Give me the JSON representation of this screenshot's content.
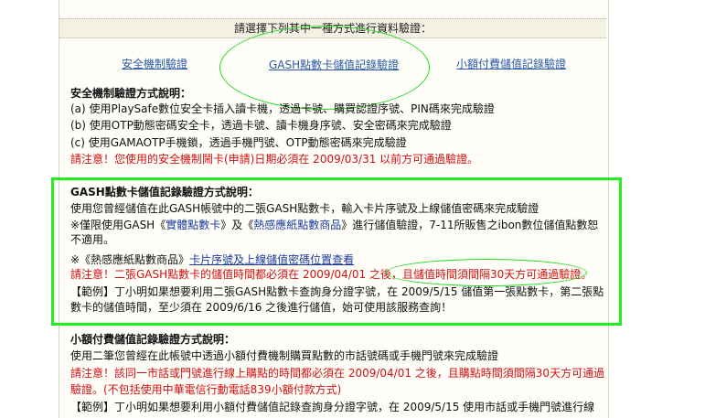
{
  "header": {
    "prompt": "請選擇下列其中一種方式進行資料驗證："
  },
  "tabs": [
    {
      "label": "安全機制驗證"
    },
    {
      "label": "GASH點數卡儲值記錄驗證"
    },
    {
      "label": "小額付費儲值記錄驗證"
    }
  ],
  "safety": {
    "title": "安全機制驗證方式說明：",
    "line_a": "(a) 使用PlaySafe數位安全卡插入讀卡機，透過卡號、購買認證序號、PIN碼來完成驗證",
    "line_b": "(b) 使用OTP動態密碼安全卡，透過卡號、讀卡機身序號、安全密碼來完成驗證",
    "line_c": "(c) 使用GAMAOTP手機鎖，透過手機門號、OTP動態密碼來完成驗證",
    "notice": "請注意！您使用的安全機制鬧卡(申請)日期必須在 2009/03/31 以前方可通過驗證。"
  },
  "gash": {
    "title": "GASH點數卡儲值記錄驗證方式說明：",
    "line1": "使用您曾經儲值在此GASH帳號中的二張GASH點數卡，輸入卡片序號及上線儲值密碼來完成驗證",
    "line2_pre": "※僅限使用GASH《",
    "line2_link1": "實體點數卡",
    "line2_mid": "》及《",
    "line2_link2": "熱感應紙點數商品",
    "line2_post": "》進行儲值驗證，7-11所販售之ibon數位儲值點數恕",
    "line3": "不適用。",
    "line4_pre": "※《熱感應紙點數商品》",
    "line4_link": "卡片序號及上線儲值密碼位置查看",
    "notice": "請注意！二張GASH點數卡的儲值時間都必須在 2009/04/01 之後，且儲值時間須間隔30天方可通過驗證。",
    "example1": "【範例】丁小明如果想要利用二張GASH點數卡查詢身分證字號，在 2009/5/15 儲值第一張點數卡，第二張點",
    "example2": "數卡的儲值時間，至少須在 2009/6/16 之後進行儲值，始可使用該服務查詢！"
  },
  "micro": {
    "title": "小額付費儲值記錄驗證方式說明：",
    "line1": "使用二筆您曾經在此帳號中透過小額付費機制購買點數的市話號碼或手機門號來完成驗證",
    "notice1": "請注意！該同一市話或門號進行線上購點的時間都必須在 2009/04/01 之後，且購點時間須間隔30天方可通過",
    "notice2": "驗證。(不包括使用中華電信行動電話839小額付款方式)",
    "example": "【範例】丁小明如果想要利用小額付費儲值記錄查詢身分證字號，在 2009/5/15 使用市話或手機門號進行線"
  }
}
